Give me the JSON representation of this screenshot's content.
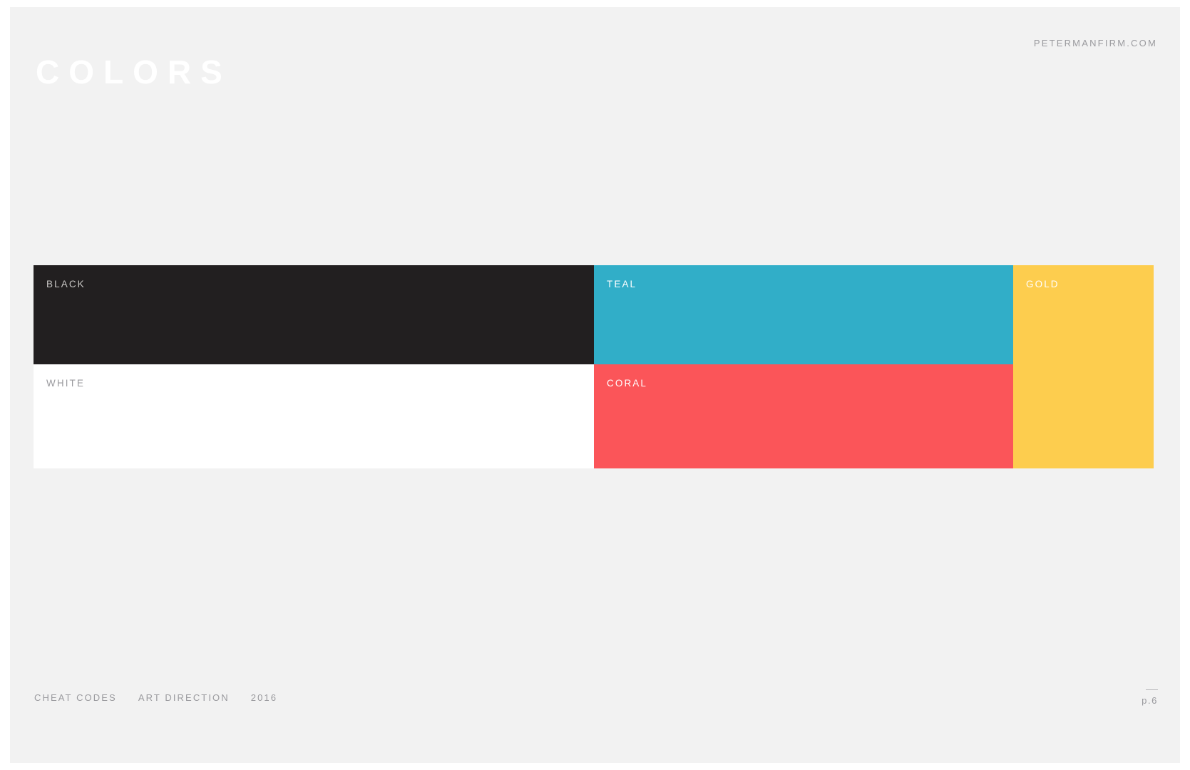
{
  "header": {
    "title": "COLORS",
    "site_url": "PETERMANFIRM.COM"
  },
  "palette": {
    "columns": [
      {
        "name": "neutral-column",
        "swatches": [
          {
            "label": "BLACK",
            "hex": "#221F20",
            "label_color": "#C8C6C4"
          },
          {
            "label": "WHITE",
            "hex": "#FFFFFF",
            "label_color": "#9A9A9E"
          }
        ]
      },
      {
        "name": "accent-column",
        "swatches": [
          {
            "label": "TEAL",
            "hex": "#31AEC8",
            "label_color": "#FFFFFF"
          },
          {
            "label": "CORAL",
            "hex": "#FB5559",
            "label_color": "#FFFFFF"
          }
        ]
      },
      {
        "name": "gold-column",
        "swatches": [
          {
            "label": "GOLD",
            "hex": "#FDCD4E",
            "label_color": "#FFFFFF"
          }
        ]
      }
    ]
  },
  "footer": {
    "segments": [
      "CHEAT CODES",
      "ART DIRECTION",
      "2016"
    ],
    "page_label": "p.6"
  },
  "theme": {
    "slide_background": "#F2F2F2",
    "muted_text": "#9A9A9E"
  }
}
